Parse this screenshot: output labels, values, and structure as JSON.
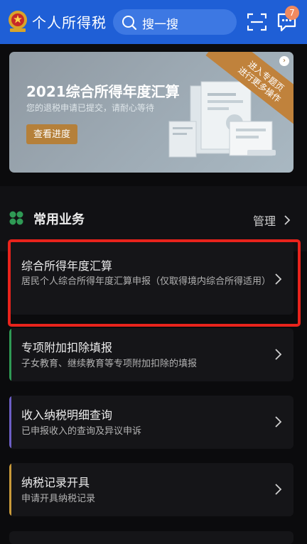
{
  "header": {
    "app_title": "个人所得税",
    "search_placeholder": "搜一搜",
    "message_badge": "7",
    "icons": [
      "national-emblem-logo",
      "search-icon",
      "scan-icon",
      "message-icon"
    ]
  },
  "banner": {
    "title": "2021综合所得年度汇算",
    "subtitle": "您的退税申请已提交，请耐心等待",
    "button_label": "查看进度",
    "corner_tag_line1": "进入专题页",
    "corner_tag_line2": "进行更多操作"
  },
  "section": {
    "title": "常用业务",
    "manage_label": "管理"
  },
  "services": [
    {
      "title": "综合所得年度汇算",
      "description": "居民个人综合所得年度汇算申报（仅取得境内综合所得适用）",
      "accent": "#151518"
    },
    {
      "title": "专项附加扣除填报",
      "description": "子女教育、继续教育等专项附加扣除的填报",
      "accent": "#2f9a55"
    },
    {
      "title": "收入纳税明细查询",
      "description": "已申报收入的查询及异议申诉",
      "accent": "#6d5fc6"
    },
    {
      "title": "纳税记录开具",
      "description": "申请开具纳税记录",
      "accent": "#c99a3a"
    }
  ],
  "colors": {
    "header_bg": "#1f5fd6",
    "highlight_border": "#e8231c",
    "banner_button": "#b5803a"
  }
}
